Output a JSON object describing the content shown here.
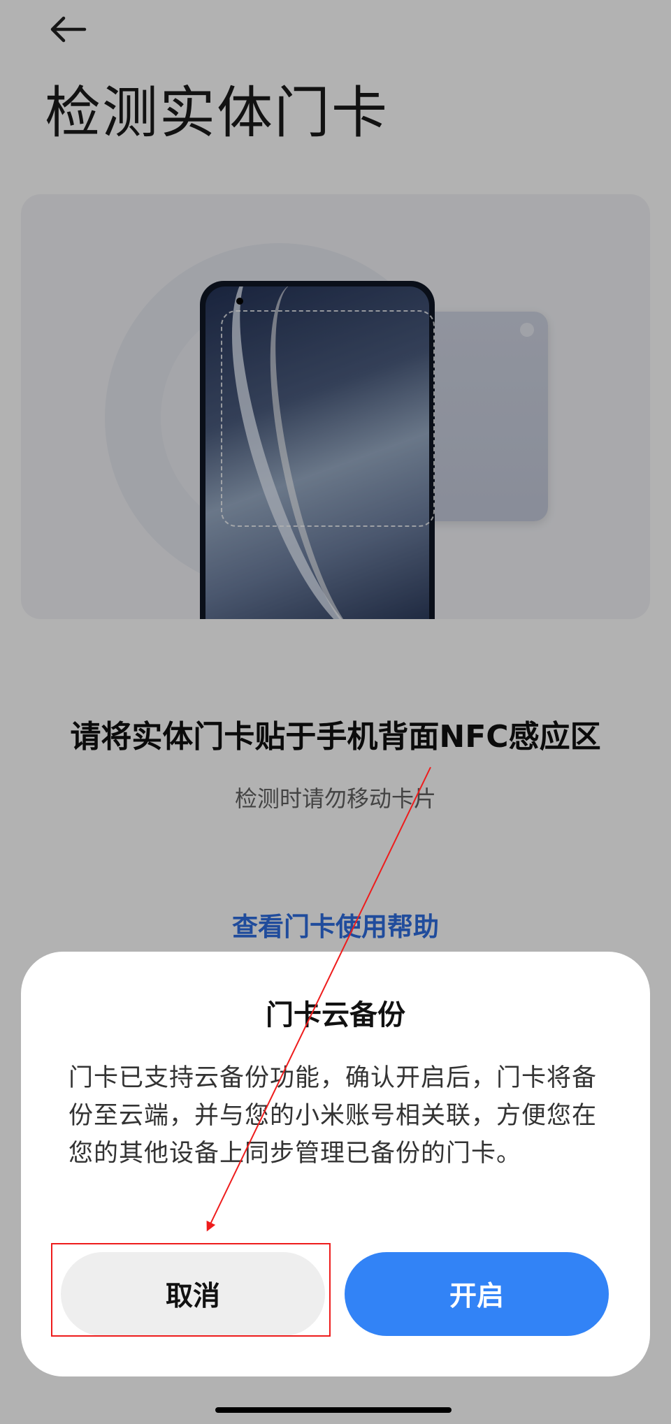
{
  "header": {
    "title": "检测实体门卡",
    "back_icon": "arrow-left-icon"
  },
  "main": {
    "instruction": "请将实体门卡贴于手机背面NFC感应区",
    "sub_instruction": "检测时请勿移动卡片",
    "help_link": "查看门卡使用帮助"
  },
  "dialog": {
    "title": "门卡云备份",
    "body": "门卡已支持云备份功能，确认开启后，门卡将备份至云端，并与您的小米账号相关联，方便您在您的其他设备上同步管理已备份的门卡。",
    "cancel_label": "取消",
    "confirm_label": "开启"
  },
  "colors": {
    "accent": "#3283f6",
    "link": "#2f6ee0",
    "annotation": "#ee1c1c"
  }
}
